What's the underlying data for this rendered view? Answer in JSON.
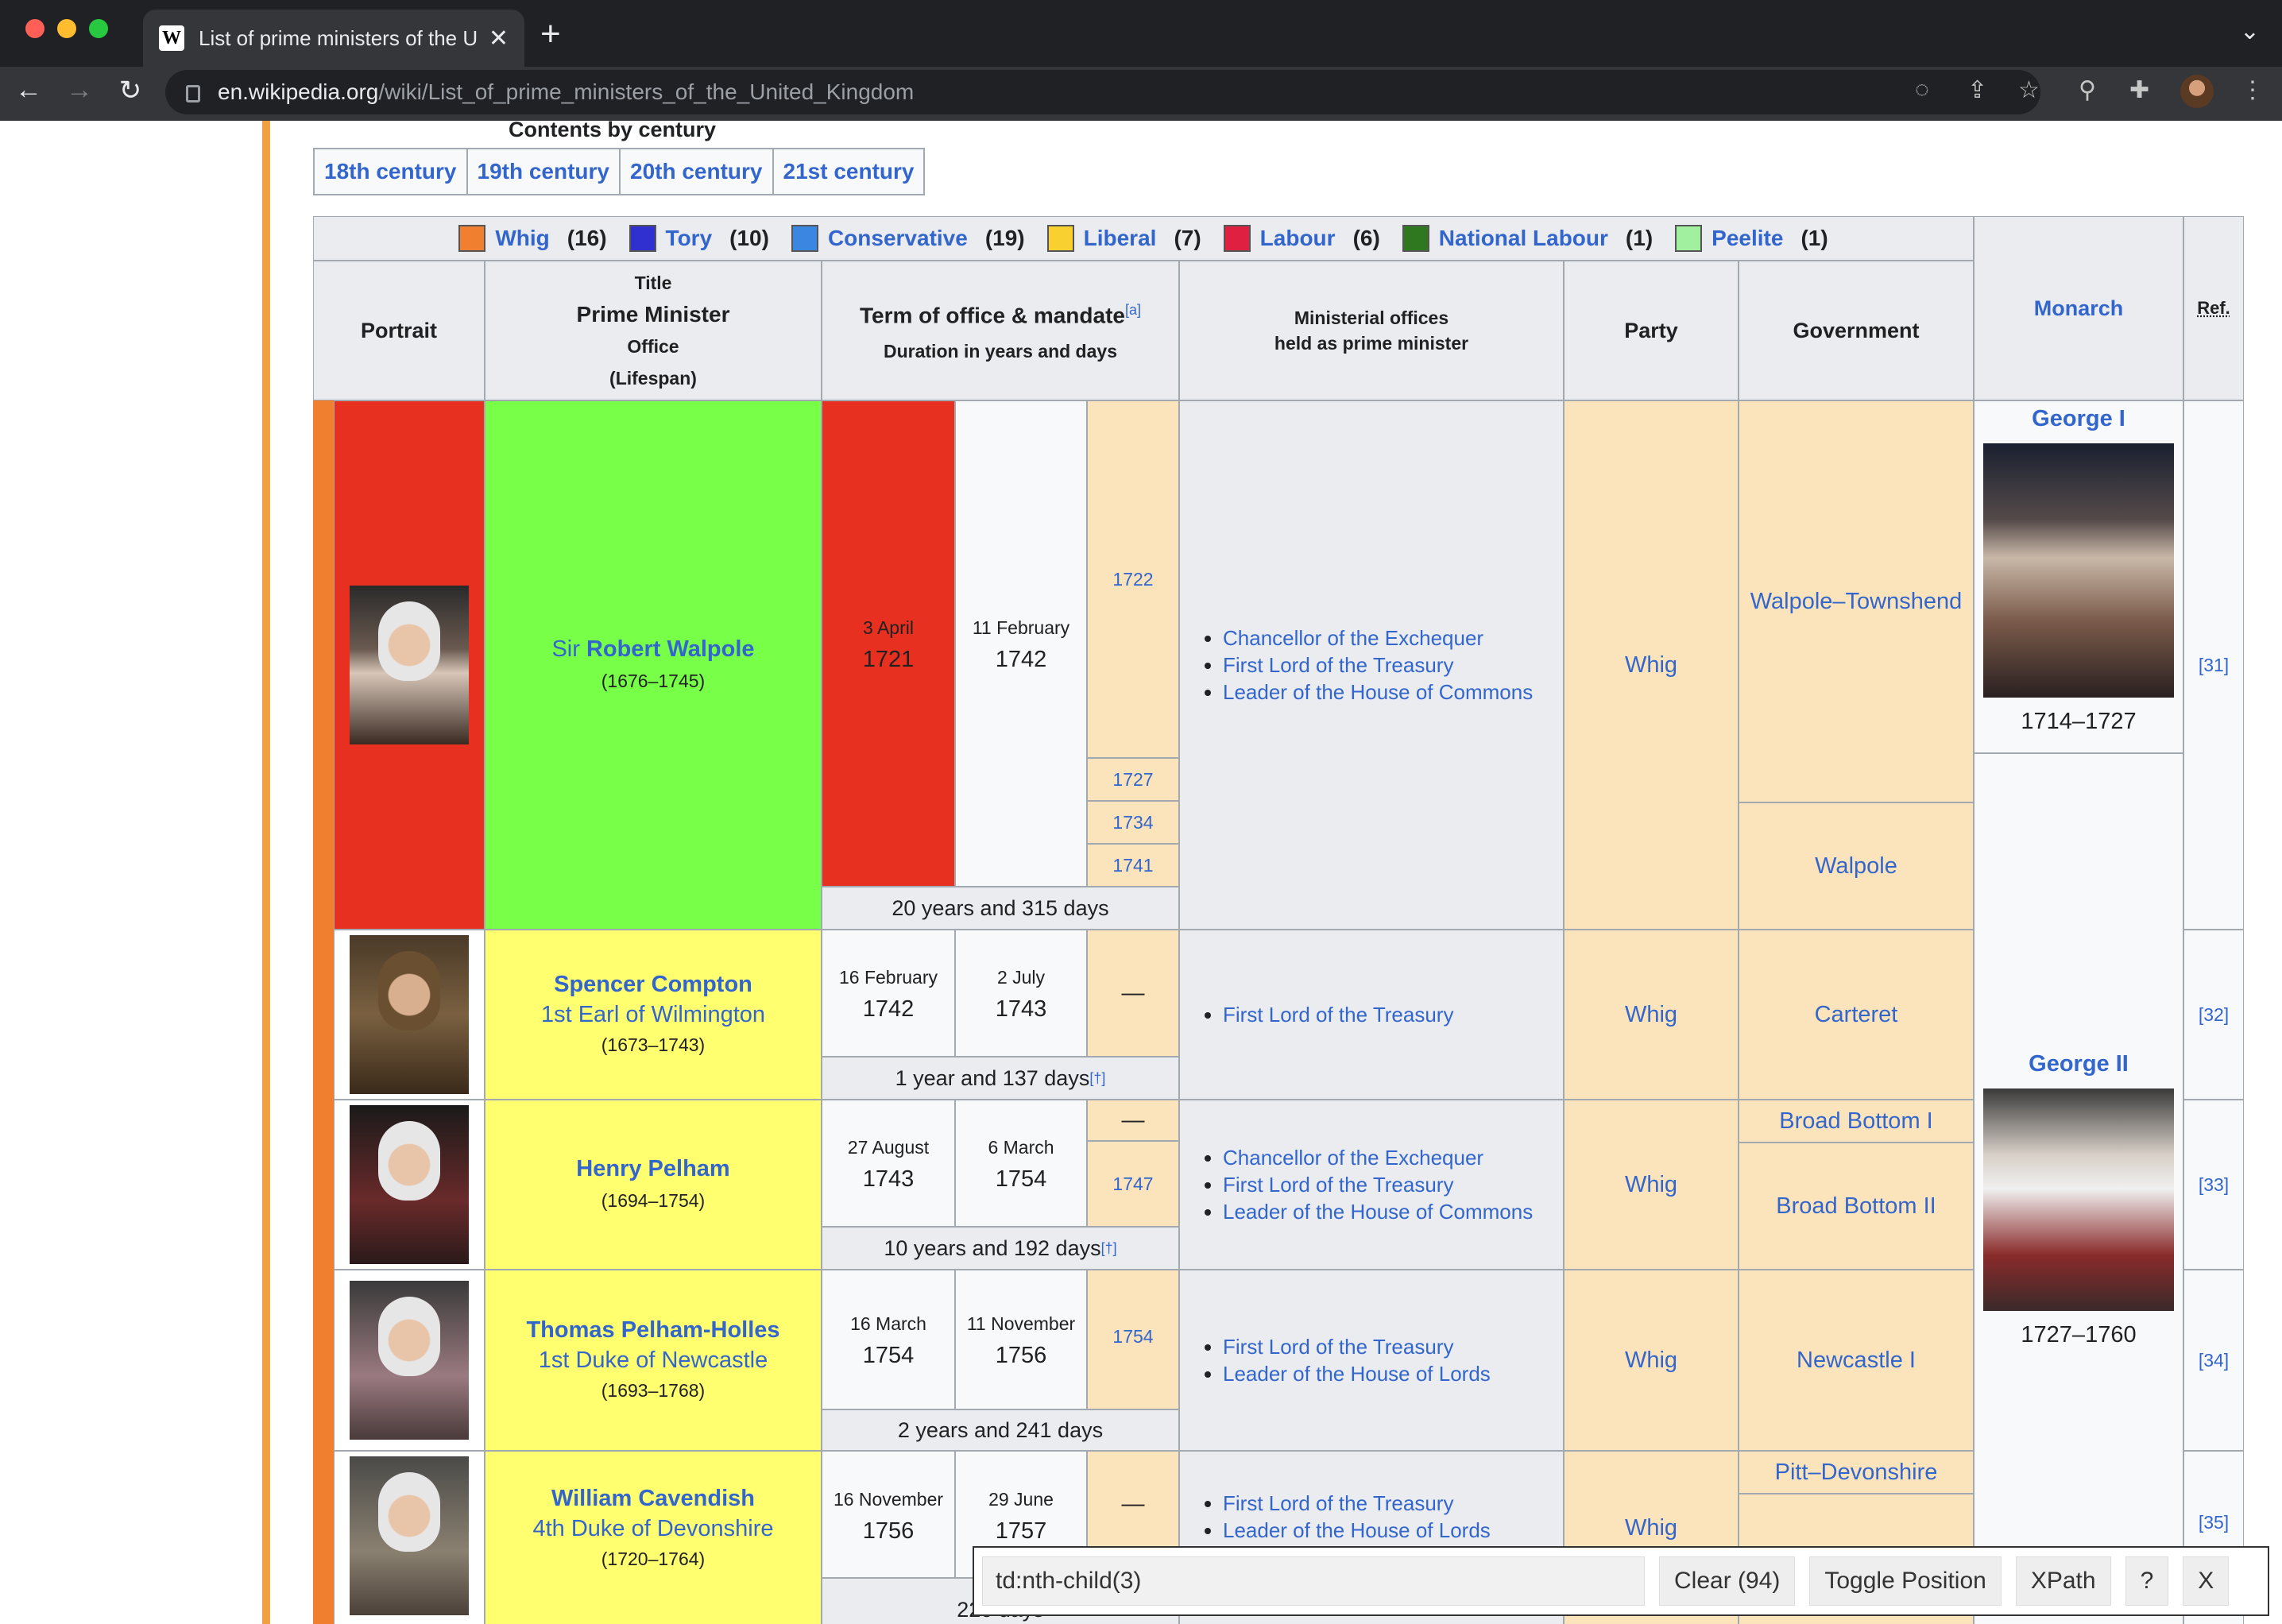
{
  "browser": {
    "tab_title": "List of prime ministers of the U",
    "url_host": "en.wikipedia.org",
    "url_path": "/wiki/List_of_prime_ministers_of_the_United_Kingdom"
  },
  "contents": {
    "title": "Contents by century",
    "links": [
      "18th century",
      "19th century",
      "20th century",
      "21st century"
    ]
  },
  "legend": [
    {
      "name": "Whig",
      "count": "(16)",
      "color": "#f08030"
    },
    {
      "name": "Tory",
      "count": "(10)",
      "color": "#3030d0"
    },
    {
      "name": "Conservative",
      "count": "(19)",
      "color": "#3a86e0"
    },
    {
      "name": "Liberal",
      "count": "(7)",
      "color": "#f8d030"
    },
    {
      "name": "Labour",
      "count": "(6)",
      "color": "#e02040"
    },
    {
      "name": "National Labour",
      "count": "(1)",
      "color": "#307820"
    },
    {
      "name": "Peelite",
      "count": "(1)",
      "color": "#a0f0a0"
    }
  ],
  "headers": {
    "portrait": "Portrait",
    "title_small": "Title",
    "prime_minister": "Prime Minister",
    "office": "Office",
    "lifespan": "(Lifespan)",
    "term": "Term of office & mandate",
    "term_note": "[a]",
    "duration": "Duration in years and days",
    "ministerial_1": "Ministerial offices",
    "ministerial_2": "held as prime minister",
    "party": "Party",
    "government": "Government",
    "monarch": "Monarch",
    "ref": "Ref."
  },
  "rows": [
    {
      "prefix": "Sir ",
      "name": "Robert Walpole",
      "title": "",
      "lifespan": "(1676–1745)",
      "start_day": "3 April",
      "start_year": "1721",
      "end_day": "11 February",
      "end_year": "1742",
      "mandates": [
        "1722",
        "1727",
        "1734",
        "1741"
      ],
      "duration": "20 years and 315 days",
      "duration_note": "",
      "offices": [
        "Chancellor of the Exchequer",
        "First Lord of the Treasury",
        "Leader of the House of Commons"
      ],
      "party": "Whig",
      "governments": [
        "Walpole–Townshend",
        "Walpole"
      ],
      "ref": "[31]"
    },
    {
      "name": "Spencer Compton",
      "title": "1st Earl of Wilmington",
      "lifespan": "(1673–1743)",
      "start_day": "16 February",
      "start_year": "1742",
      "end_day": "2 July",
      "end_year": "1743",
      "mandates": [
        "—"
      ],
      "duration": "1 year and 137 days",
      "duration_note": "[†]",
      "offices": [
        "First Lord of the Treasury"
      ],
      "party": "Whig",
      "governments": [
        "Carteret"
      ],
      "ref": "[32]"
    },
    {
      "name": "Henry Pelham",
      "title": "",
      "lifespan": "(1694–1754)",
      "start_day": "27 August",
      "start_year": "1743",
      "end_day": "6 March",
      "end_year": "1754",
      "mandates": [
        "—",
        "1747"
      ],
      "duration": "10 years and 192 days",
      "duration_note": "[†]",
      "offices": [
        "Chancellor of the Exchequer",
        "First Lord of the Treasury",
        "Leader of the House of Commons"
      ],
      "party": "Whig",
      "governments": [
        "Broad Bottom I",
        "Broad Bottom II"
      ],
      "ref": "[33]"
    },
    {
      "name": "Thomas Pelham-Holles",
      "title": "1st Duke of Newcastle",
      "lifespan": "(1693–1768)",
      "start_day": "16 March",
      "start_year": "1754",
      "end_day": "11 November",
      "end_year": "1756",
      "mandates": [
        "1754"
      ],
      "duration": "2 years and 241 days",
      "duration_note": "",
      "offices": [
        "First Lord of the Treasury",
        "Leader of the House of Lords"
      ],
      "party": "Whig",
      "governments": [
        "Newcastle I"
      ],
      "ref": "[34]"
    },
    {
      "name": "William Cavendish",
      "title": "4th Duke of Devonshire",
      "lifespan": "(1720–1764)",
      "start_day": "16 November",
      "start_year": "1756",
      "end_day": "29 June",
      "end_year": "1757",
      "mandates": [
        "—"
      ],
      "duration": "220 days",
      "duration_note": "",
      "offices": [
        "First Lord of the Treasury",
        "Leader of the House of Lords"
      ],
      "party": "Whig",
      "governments": [
        "Pitt–Devonshire"
      ],
      "ref": "[35]"
    }
  ],
  "monarchs": [
    {
      "name": "George I",
      "reign": "1714–1727"
    },
    {
      "name": "George II",
      "reign": "1727–1760"
    }
  ],
  "colors": {
    "whig": "#f08030",
    "highlight_red": "#e83020",
    "highlight_green": "#78ff48",
    "highlight_yellow": "#ffff70",
    "whig_cell": "#fbe4bc",
    "offices_bg": "#eaecf0"
  },
  "finder": {
    "query": "td:nth-child(3)",
    "clear": "Clear (94)",
    "toggle": "Toggle Position",
    "xpath": "XPath",
    "help": "?",
    "close": "X"
  }
}
